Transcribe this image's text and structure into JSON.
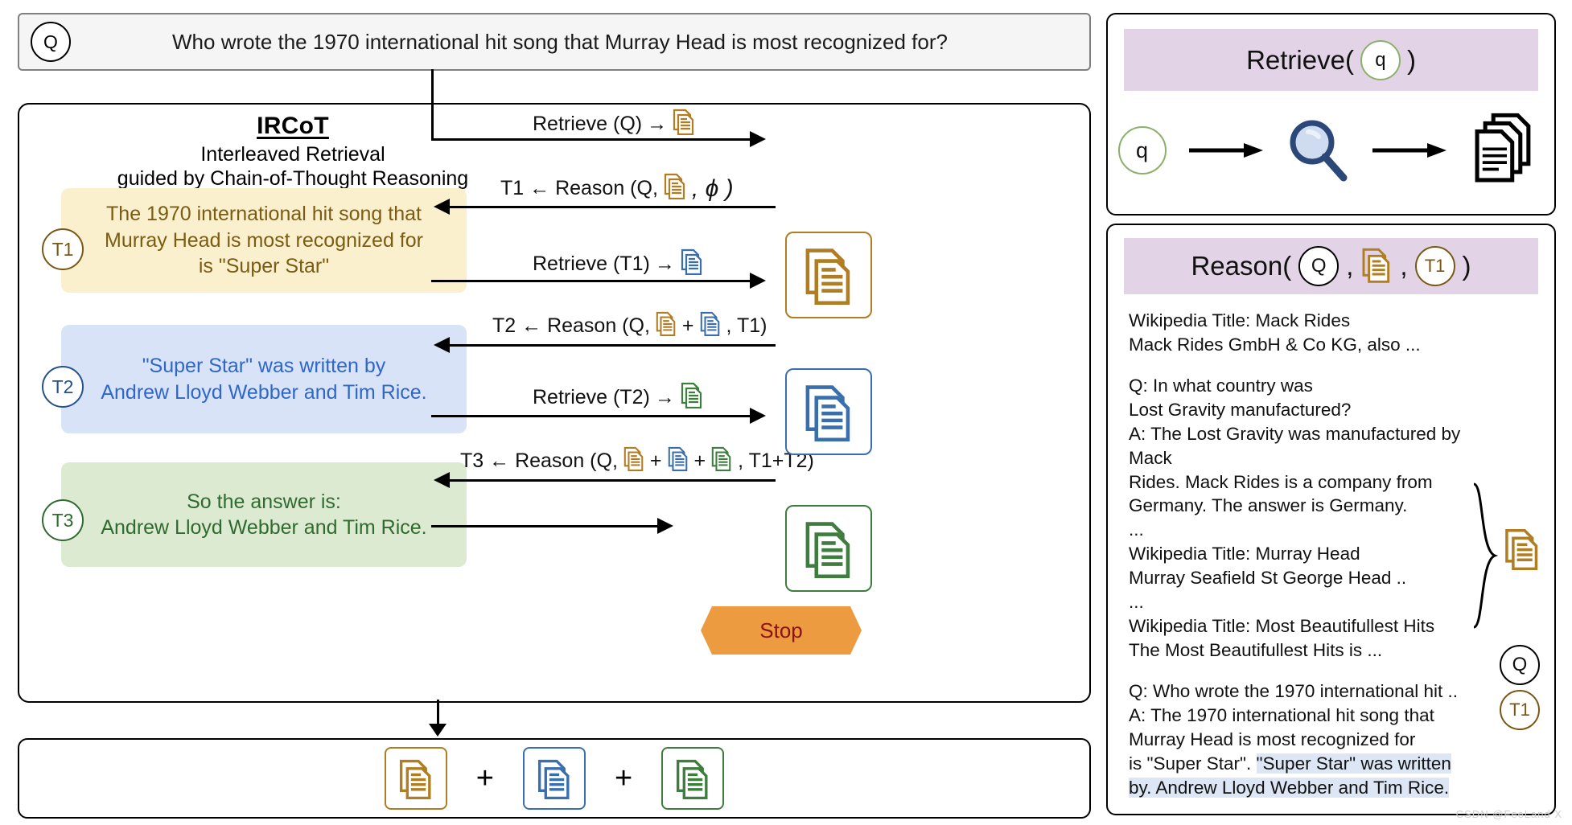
{
  "question": {
    "badge": "Q",
    "text": "Who wrote the 1970 international hit song that Murray Head is most recognized for?"
  },
  "ircot": {
    "title": "IRCoT",
    "subtitle_line1": "Interleaved Retrieval",
    "subtitle_line2": "guided by Chain-of-Thought Reasoning",
    "thoughts": [
      {
        "badge": "T1",
        "line1": "The 1970 international hit song that",
        "line2": "Murray Head is most recognized for",
        "line3": "is \"Super Star\"",
        "color": "#7a5c12",
        "bg": "#faf0ce"
      },
      {
        "badge": "T2",
        "line1": "\"Super Star\" was written by",
        "line2": "Andrew Lloyd Webber and Tim Rice.",
        "line3": "",
        "color": "#2e67c9",
        "bg": "#d9e3f7"
      },
      {
        "badge": "T3",
        "line1": "So the answer is:",
        "line2": "Andrew Lloyd Webber and Tim Rice.",
        "line3": "",
        "color": "#2f6b2f",
        "bg": "#dcead1"
      }
    ],
    "steps": [
      {
        "label_pre": "Retrieve (Q)",
        "arrow": "→",
        "label_post": "",
        "direction": "right"
      },
      {
        "label_pre": "T1 ← Reason (Q,",
        "arrow": "",
        "label_post": ", ϕ )",
        "direction": "left"
      },
      {
        "label_pre": "Retrieve (T1)",
        "arrow": "→",
        "label_post": "",
        "direction": "right"
      },
      {
        "label_pre": "T2 ← Reason (Q,",
        "arrow": "",
        "label_post": ", T1)",
        "direction": "left"
      },
      {
        "label_pre": "Retrieve (T2)",
        "arrow": "→",
        "label_post": "",
        "direction": "right"
      },
      {
        "label_pre": "T3 ← Reason (Q,",
        "arrow": "",
        "label_post": ", T1+T2)",
        "direction": "left"
      }
    ],
    "stop_label": "Stop",
    "plus_symbol": "+"
  },
  "retrieve_panel": {
    "header_pre": "Retrieve(",
    "header_badge": "q",
    "header_post": ")",
    "query_badge": "q",
    "icons": [
      "query-circle",
      "magnifier-icon",
      "document-stack-icon"
    ]
  },
  "reason_panel": {
    "header_pre": "Reason(",
    "header_badge_q": "Q",
    "header_comma1": ",",
    "header_doc": "document-icon",
    "header_comma2": ",",
    "header_badge_t1": "T1",
    "header_post": ")",
    "body": {
      "para1_line1": "Wikipedia Title: Mack Rides",
      "para1_line2": "Mack Rides GmbH & Co KG, also ...",
      "para2_line1": "Q: In what country was",
      "para2_line2": "Lost Gravity manufactured?",
      "para2_line3": "A: The Lost Gravity was manufactured by Mack",
      "para2_line4": "Rides. Mack Rides is a company from",
      "para2_line5": "Germany. The answer is Germany.",
      "ellipsis1": "...",
      "para3_line1": "Wikipedia Title: Murray Head",
      "para3_line2": "Murray Seafield St George Head ..",
      "ellipsis2": "...",
      "para3_line3": "Wikipedia Title: Most Beautifullest Hits",
      "para3_line4": "The Most Beautifullest Hits is ...",
      "para4_line1": "Q: Who wrote the 1970 international hit ..",
      "para4_line2": "A: The 1970 international hit song that",
      "para4_line3": "Murray Head is most recognized for",
      "para4_line4_plain": "is \"Super Star\". ",
      "para4_line4_hl": "\"Super Star\" was written",
      "para4_line5_hl": "by. Andrew Lloyd Webber and Tim Rice."
    },
    "side_markers": {
      "q": "Q",
      "t1": "T1"
    }
  },
  "watermark": "CSDN @FeeLand X",
  "colors": {
    "brown": "#b07d22",
    "blue": "#3a6fae",
    "green": "#3f7d3f",
    "orange": "#ed9b41",
    "stop_text": "#8c1111",
    "header_purple": "#e2d4e6",
    "highlight": "#dce6f5"
  }
}
